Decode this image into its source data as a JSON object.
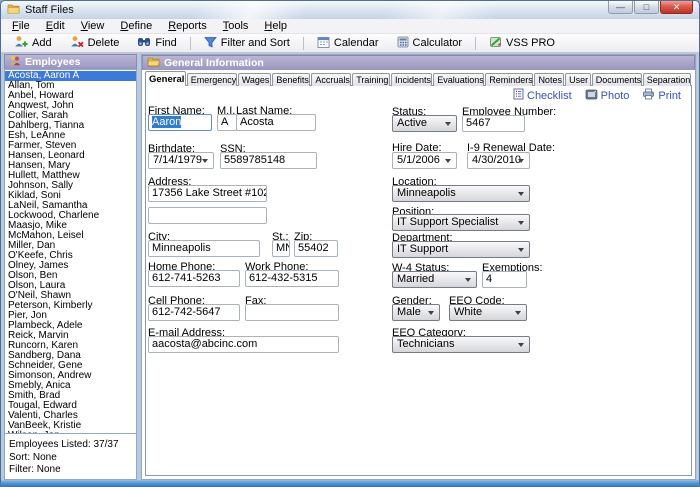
{
  "window": {
    "title": "Staff Files"
  },
  "icons": {
    "minimize": "—",
    "maximize": "□",
    "close": "✕"
  },
  "menu": {
    "items": [
      "File",
      "Edit",
      "View",
      "Define",
      "Reports",
      "Tools",
      "Help"
    ]
  },
  "toolbar": {
    "add": "Add",
    "delete": "Delete",
    "find": "Find",
    "filter_sort": "Filter and Sort",
    "calendar": "Calendar",
    "calculator": "Calculator",
    "vss_pro": "VSS PRO"
  },
  "sidebar": {
    "header": "Employees",
    "selected": "Acosta, Aaron A",
    "employees": [
      "Acosta, Aaron A",
      "Allan, Tom",
      "Anbel, Howard",
      "Anqwest, John",
      "Collier, Sarah",
      "Dahlberg, Tianna",
      "Esh, LeAnne",
      "Farmer, Steven",
      "Hansen, Leonard",
      "Hansen, Mary",
      "Hullett, Matthew",
      "Johnson, Sally",
      "Kiklad, Soni",
      "LaNeil, Samantha",
      "Lockwood, Charlene",
      "Maasjo, Mike",
      "McMahon, Leisel",
      "Miller, Dan",
      "O'Keefe, Chris",
      "Olney, James",
      "Olson, Ben",
      "Olson, Laura",
      "O'Neil, Shawn",
      "Peterson, Kimberly",
      "Pier, Jon",
      "Plambeck, Adele",
      "Reick, Marvin",
      "Runcorn, Karen",
      "Sandberg, Dana",
      "Schneider, Gene",
      "Simonson, Andrew",
      "Smebly, Anica",
      "Smith, Brad",
      "Tougal, Edward",
      "Valenti, Charles",
      "VanBeek, Kristie",
      "Wilson, Jon"
    ],
    "footer": {
      "listed": "Employees Listed: 37/37",
      "sort": "Sort: None",
      "filter": "Filter: None"
    }
  },
  "main": {
    "header": "General Information",
    "active_tab": "General",
    "tabs": [
      "General",
      "Emergency",
      "Wages",
      "Benefits",
      "Accruals",
      "Training",
      "Incidents",
      "Evaluations",
      "Reminders",
      "Notes",
      "User",
      "Documents",
      "Separation"
    ],
    "actions": {
      "checklist": "Checklist",
      "photo": "Photo",
      "print": "Print"
    },
    "form": {
      "first_name": {
        "label": "First Name:",
        "value": "Aaron"
      },
      "mi": {
        "label": "M.I.",
        "value": "A"
      },
      "last_name": {
        "label": "Last Name:",
        "value": "Acosta"
      },
      "birthdate": {
        "label": "Birthdate:",
        "value": "7/14/1979"
      },
      "ssn": {
        "label": "SSN:",
        "value": "5589785148"
      },
      "address": {
        "label": "Address:",
        "line1": "17356 Lake Street #102",
        "line2": ""
      },
      "city": {
        "label": "City:",
        "value": "Minneapolis"
      },
      "state": {
        "label": "St.:",
        "value": "MN"
      },
      "zip": {
        "label": "Zip:",
        "value": "55402"
      },
      "home_phone": {
        "label": "Home Phone:",
        "value": "612-741-5263"
      },
      "work_phone": {
        "label": "Work Phone:",
        "value": "612-432-5315"
      },
      "cell_phone": {
        "label": "Cell Phone:",
        "value": "612-742-5647"
      },
      "fax": {
        "label": "Fax:",
        "value": ""
      },
      "email": {
        "label": "E-mail Address:",
        "value": "aacosta@abcinc.com"
      },
      "status": {
        "label": "Status:",
        "value": "Active"
      },
      "employee_number": {
        "label": "Employee Number:",
        "value": "5467"
      },
      "hire_date": {
        "label": "Hire Date:",
        "value": "5/1/2006"
      },
      "i9_renewal_date": {
        "label": "I-9 Renewal Date:",
        "value": "4/30/2010"
      },
      "location": {
        "label": "Location:",
        "value": "Minneapolis"
      },
      "position": {
        "label": "Position:",
        "value": "IT Support Specialist"
      },
      "department": {
        "label": "Department:",
        "value": "IT Support"
      },
      "w4_status": {
        "label": "W-4 Status:",
        "value": "Married"
      },
      "exemptions": {
        "label": "Exemptions:",
        "value": "4"
      },
      "gender": {
        "label": "Gender:",
        "value": "Male"
      },
      "eeo_code": {
        "label": "EEO Code:",
        "value": "White"
      },
      "eeo_category": {
        "label": "EEO Category:",
        "value": "Technicians"
      }
    }
  },
  "colors": {
    "header_bar": "#a7a3c9",
    "selection": "#3a7add",
    "link": "#3b4fc1",
    "close_button": "#dc5949"
  }
}
